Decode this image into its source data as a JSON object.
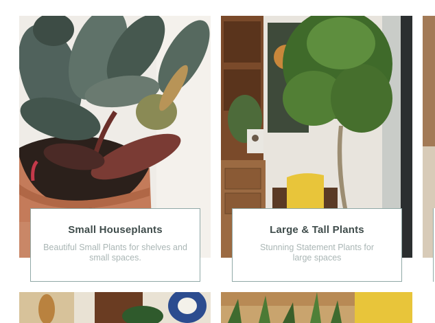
{
  "cards": [
    {
      "title": "Small Houseplants",
      "description": "Beautiful Small Plants for shelves and small spaces."
    },
    {
      "title": "Large & Tall Plants",
      "description": "Stunning Statement Plants for large spaces"
    }
  ]
}
